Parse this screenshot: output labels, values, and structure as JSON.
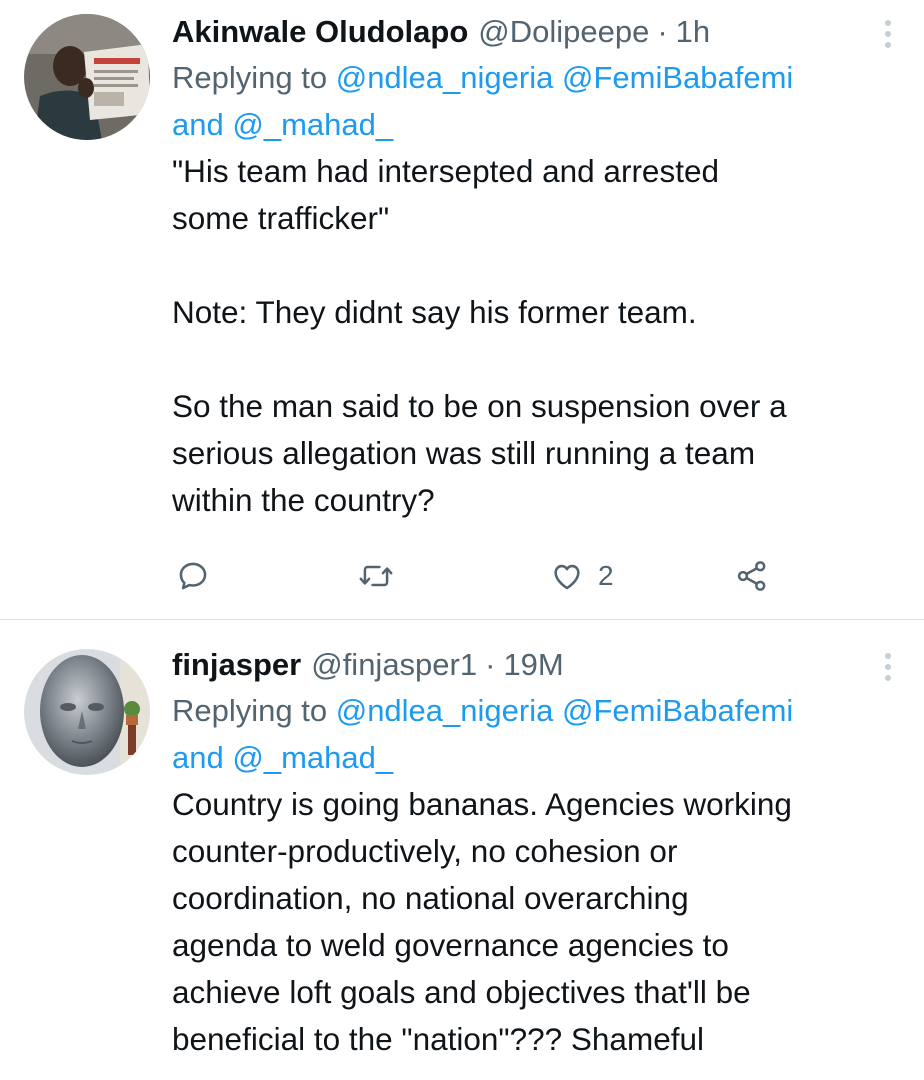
{
  "tweets": [
    {
      "display_name": "Akinwale Oludolapo",
      "handle": "@Dolipeepe",
      "separator": "·",
      "time": "1h",
      "replying_prefix": "Replying to",
      "mention_1": "@ndlea_nigeria",
      "mention_2": "@FemiBabafemi",
      "conjunction": "and",
      "mention_3": "@_mahad_",
      "text": "\"His team had intersepted and arrested\nsome trafficker\"\n\nNote: They didnt say his former team.\n\nSo the man said to be on suspension over a\nserious allegation was still running a team\nwithin the country?",
      "like_count": "2",
      "icons": {
        "avatar": "man-reading-newspaper-avatar",
        "more": "more-options-icon",
        "reply": "reply-icon",
        "retweet": "retweet-icon",
        "like": "heart-icon",
        "share": "share-icon"
      }
    },
    {
      "display_name": "finjasper",
      "handle": "@finjasper1",
      "separator": "·",
      "time": "19M",
      "replying_prefix": "Replying to",
      "mention_1": "@ndlea_nigeria",
      "mention_2": "@FemiBabafemi",
      "conjunction": "and",
      "mention_3": "@_mahad_",
      "text": "Country is going bananas. Agencies working\ncounter-productively, no cohesion or\ncoordination, no national overarching\nagenda to weld governance agencies to\nachieve loft goals and objectives that'll be\nbeneficial to the \"nation\"??? Shameful",
      "icons": {
        "avatar": "metallic-head-sculpture-avatar",
        "more": "more-options-icon"
      }
    }
  ],
  "colors": {
    "text": "#0f1419",
    "secondary": "#536471",
    "link": "#1d9bf0",
    "divider": "#d9dfe3"
  }
}
